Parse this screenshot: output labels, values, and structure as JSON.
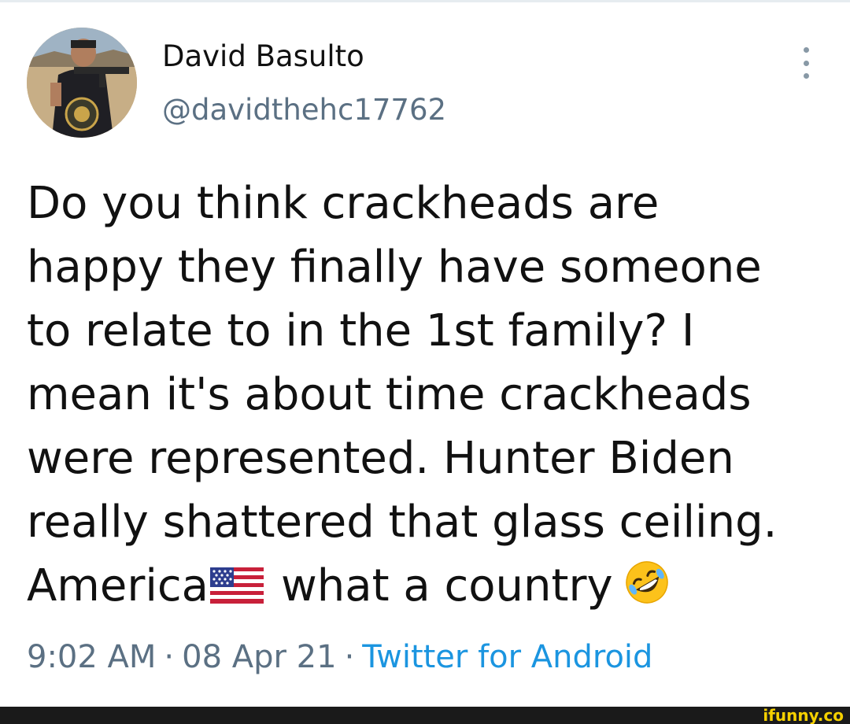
{
  "tweet": {
    "display_name": "David Basulto",
    "handle": "@davidthehc17762",
    "text_lines": [
      "Do you think crackheads are",
      "happy they finally have someone",
      "to relate to in the 1st family? I",
      "mean it's about time crackheads",
      "were represented. Hunter Biden",
      "really shattered that glass ceiling.",
      "America",
      "what a country"
    ],
    "flag_emoji": "us-flag-icon",
    "laugh_emoji": "rolling-on-floor-laughing-icon",
    "time": "9:02 AM",
    "separator": "·",
    "date": "08 Apr 21",
    "source": "Twitter for Android"
  },
  "watermark": "ifunny.co",
  "colors": {
    "text": "#111111",
    "secondary": "#5b7083",
    "link": "#1b95e0",
    "watermark": "#f5d000"
  }
}
